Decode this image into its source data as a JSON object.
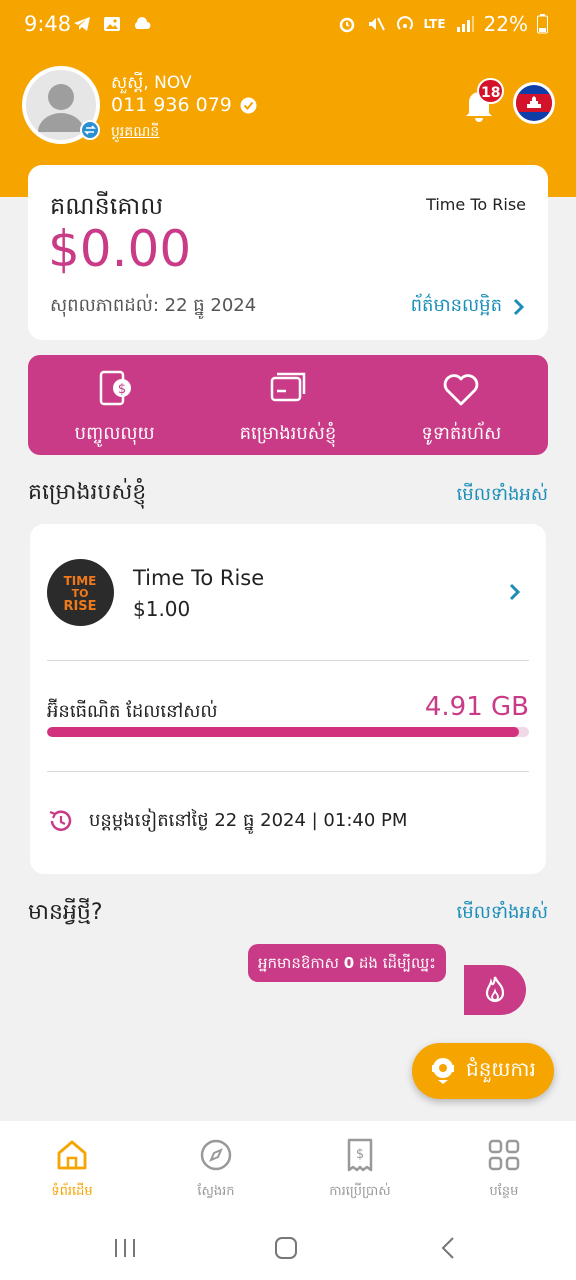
{
  "status_bar": {
    "time": "9:48",
    "network": "LTE",
    "battery": "22%"
  },
  "header": {
    "greeting": "សួស្ដី, NOV",
    "phone": "011 936 079",
    "switch_account": "ប្ដូរគណនី",
    "notification_count": "18"
  },
  "account": {
    "title": "គណនីគោល",
    "plan": "Time To Rise",
    "balance": "$0.00",
    "valid_until": "សុពលភាពដល់: 22 ធ្នូ 2024",
    "details_link": "ព័ត៌មានលម្អិត"
  },
  "actions": [
    {
      "label": "បញ្ចូលលុយ",
      "icon": "topup-icon"
    },
    {
      "label": "គម្រោងរបស់ខ្ញុំ",
      "icon": "card-icon"
    },
    {
      "label": "ទូទាត់រហ័ស",
      "icon": "heart-icon"
    }
  ],
  "my_plans": {
    "title": "គម្រោងរបស់ខ្ញុំ",
    "see_all": "មើលទាំងអស់",
    "plan_name": "Time To Rise",
    "plan_price": "$1.00",
    "logo_lines": [
      "TIME",
      "TO",
      "RISE"
    ],
    "data_label": "អ៊ីនធើណិត ដែលនៅសល់",
    "data_value": "4.91 GB",
    "data_remaining_fraction": 0.98,
    "renew_text": "បន្តម្តងទៀតនៅថ្ងៃ 22 ធ្នូ 2024 | 01:40 PM"
  },
  "whats_new": {
    "title": "មានអ្វីថ្មី?",
    "see_all": "មើលទាំងអស់",
    "tooltip_before": "អ្នកមានឱកាស ",
    "tooltip_count": "0",
    "tooltip_after": " ដង ដើម្បីឈ្នះ"
  },
  "help_button": "ជំនួយការ",
  "bottom_nav": [
    {
      "label": "ទំព័រដើម",
      "icon": "home-icon",
      "active": true
    },
    {
      "label": "ស្វែងរក",
      "icon": "compass-icon",
      "active": false
    },
    {
      "label": "ការប្រើប្រាស់",
      "icon": "receipt-icon",
      "active": false
    },
    {
      "label": "បន្ថែម",
      "icon": "grid-icon",
      "active": false
    }
  ],
  "colors": {
    "brand_orange": "#f5a400",
    "brand_magenta": "#c93a87",
    "link_blue": "#1a8eb8"
  }
}
